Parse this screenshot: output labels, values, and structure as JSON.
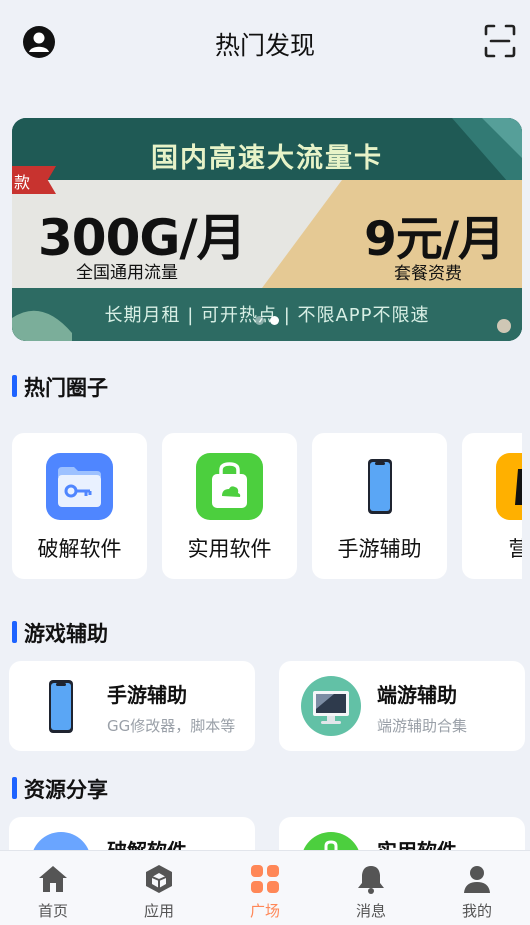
{
  "header": {
    "title": "热门发现",
    "avatar_icon": "user-circle-icon",
    "scan_icon": "scan-icon"
  },
  "banner": {
    "headline": "国内高速大流量卡",
    "tag": "款",
    "data_amount": "300G/月",
    "data_caption": "全国通用流量",
    "price": "9元/月",
    "price_caption": "套餐资费",
    "bottom_text": "长期月租 | 可开热点 | 不限APP不限速",
    "slide_count": 2,
    "active_slide": 2
  },
  "sections": {
    "hot_circles": {
      "title": "热门圈子",
      "items": [
        {
          "label": "破解软件",
          "icon": "folder-key-icon"
        },
        {
          "label": "实用软件",
          "icon": "shopping-bag-icon"
        },
        {
          "label": "手游辅助",
          "icon": "phone-icon"
        },
        {
          "label": "营养",
          "icon": "app-icon"
        }
      ]
    },
    "game_helpers": {
      "title": "游戏辅助",
      "items": [
        {
          "title": "手游辅助",
          "subtitle": "GG修改器，脚本等",
          "icon": "phone-icon"
        },
        {
          "title": "端游辅助",
          "subtitle": "端游辅助合集",
          "icon": "monitor-icon"
        }
      ]
    },
    "resources": {
      "title": "资源分享",
      "items": [
        {
          "title": "破解软件",
          "icon": "folder-key-icon"
        },
        {
          "title": "实用软件",
          "icon": "shopping-bag-icon"
        }
      ]
    }
  },
  "tabbar": {
    "active": "广场",
    "active_color": "#ff8757",
    "items": [
      {
        "label": "首页",
        "icon": "home-icon"
      },
      {
        "label": "应用",
        "icon": "cube-icon"
      },
      {
        "label": "广场",
        "icon": "grid-icon"
      },
      {
        "label": "消息",
        "icon": "bell-icon"
      },
      {
        "label": "我的",
        "icon": "person-icon"
      }
    ]
  },
  "colors": {
    "background": "#eef1f7",
    "accent_blue": "#1e63ff",
    "banner_green": "#1f5a55"
  }
}
